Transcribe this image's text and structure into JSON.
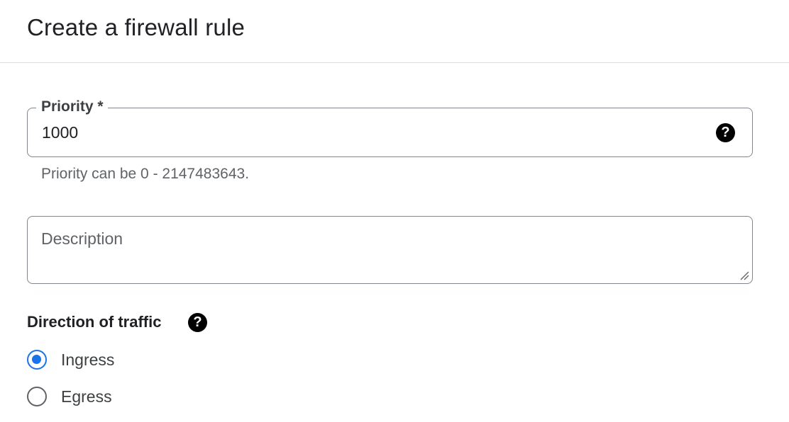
{
  "header": {
    "title": "Create a firewall rule"
  },
  "priority": {
    "label": "Priority *",
    "value": "1000",
    "help_icon": "question-circle-icon",
    "hint": "Priority can be 0 - 2147483643."
  },
  "description": {
    "placeholder": "Description",
    "value": ""
  },
  "direction": {
    "label": "Direction of traffic",
    "help_icon": "question-circle-icon",
    "options": [
      {
        "label": "Ingress",
        "selected": true
      },
      {
        "label": "Egress",
        "selected": false
      }
    ]
  },
  "colors": {
    "accent": "#1a73e8",
    "border": "#80868b",
    "divider": "#dadce0"
  }
}
